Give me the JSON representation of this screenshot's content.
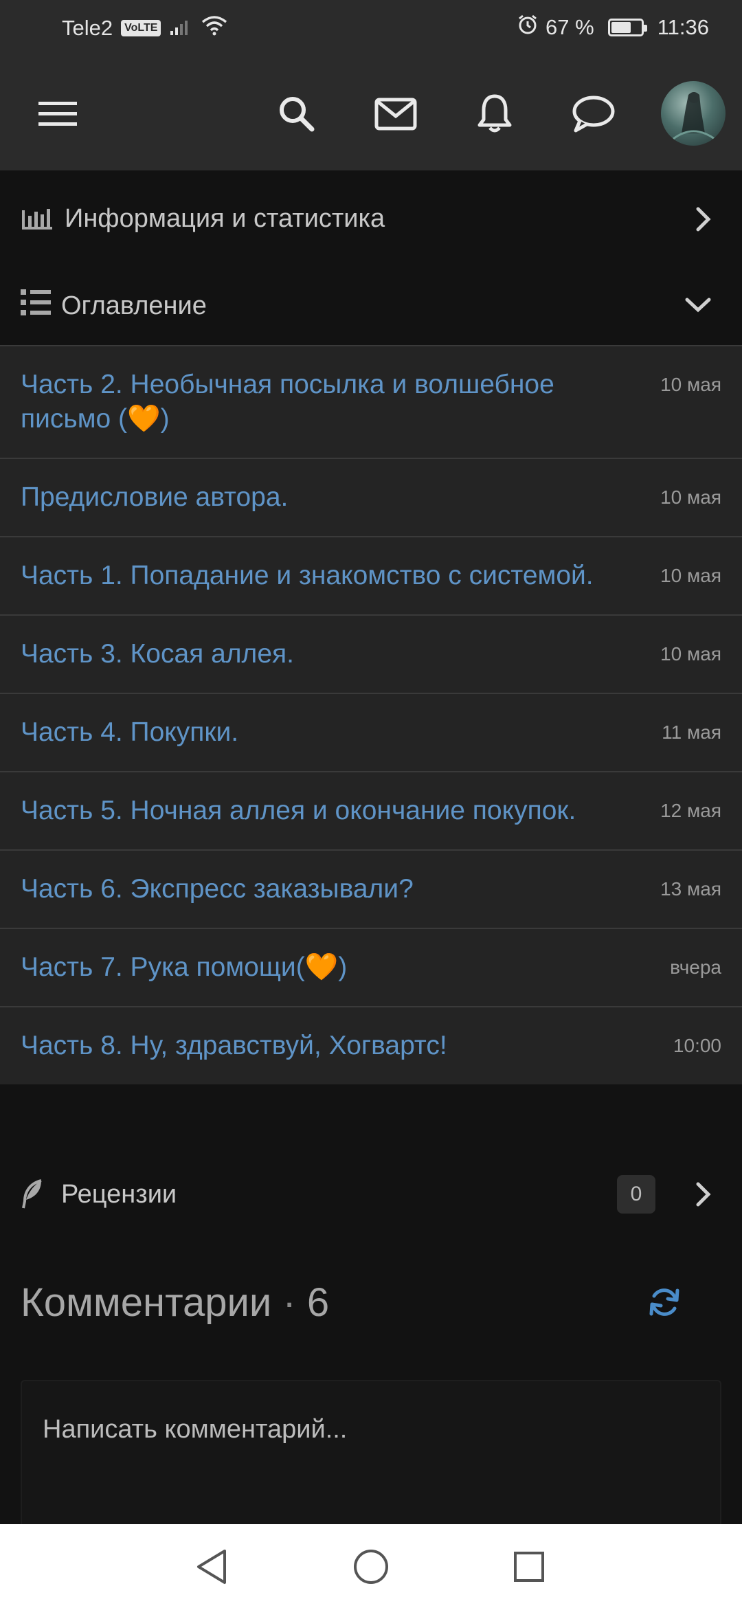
{
  "status_bar": {
    "carrier": "Tele2",
    "volte": "VoLTE",
    "battery_percent": "67 %",
    "battery_level": 0.67,
    "time": "11:36"
  },
  "header": {
    "icons": [
      "menu-icon",
      "search-icon",
      "mail-icon",
      "bell-icon",
      "chat-icon"
    ],
    "avatar": "user-avatar"
  },
  "sections": {
    "info_label": "Информация и статистика",
    "toc_label": "Оглавление",
    "reviews_label": "Рецензии",
    "reviews_count": "0"
  },
  "chapters": [
    {
      "title": "Часть 2. Необычная посылка и волшебное письмо (🧡)",
      "date": "10 мая"
    },
    {
      "title": "Предисловие автора.",
      "date": "10 мая"
    },
    {
      "title": "Часть 1. Попадание и знакомство с системой.",
      "date": "10 мая"
    },
    {
      "title": "Часть 3. Косая аллея.",
      "date": "10 мая"
    },
    {
      "title": "Часть 4. Покупки.",
      "date": "11 мая"
    },
    {
      "title": "Часть 5. Ночная аллея и окончание покупок.",
      "date": "12 мая"
    },
    {
      "title": "Часть 6. Экспресс заказывали?",
      "date": "13 мая"
    },
    {
      "title": "Часть 7. Рука помощи(🧡)",
      "date": "вчера"
    },
    {
      "title": "Часть 8. Ну, здравствуй, Хогвартс!",
      "date": "10:00"
    }
  ],
  "comments": {
    "title": "Комментарии",
    "separator": "·",
    "count": "6",
    "placeholder": "Написать комментарий..."
  },
  "colors": {
    "link": "#5f94c7",
    "accent": "#4a8cc9",
    "background": "#121212",
    "row_background": "#242424"
  }
}
